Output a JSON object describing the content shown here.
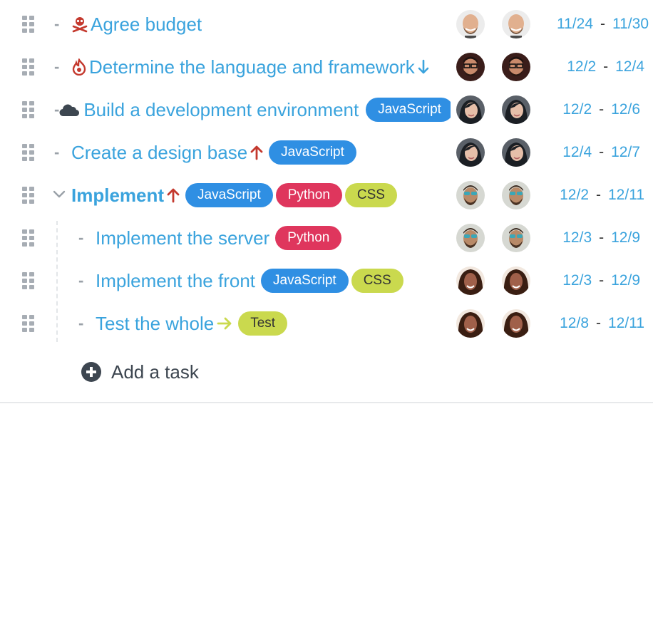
{
  "tasks": [
    {
      "title": "Agree budget",
      "icon": "skull-crossbones-icon",
      "arrow": "",
      "tags": [],
      "start": "11/24",
      "end": "11/30",
      "assignee": "bald-man"
    },
    {
      "title": "Determine the language and framework",
      "icon": "fire-icon",
      "arrow": "down",
      "tags": [],
      "start": "12/2",
      "end": "12/4",
      "assignee": "bearded-man-glasses"
    },
    {
      "title": "Build a development environment",
      "icon": "cloud-icon",
      "arrow": "",
      "tags": [
        "JavaScript"
      ],
      "start": "12/2",
      "end": "12/6",
      "assignee": "dark-haired-woman"
    },
    {
      "title": "Create a design base",
      "icon": "",
      "arrow": "up",
      "tags": [
        "JavaScript"
      ],
      "start": "12/4",
      "end": "12/7",
      "assignee": "dark-haired-woman"
    },
    {
      "title": "Implement",
      "icon": "",
      "arrow": "up",
      "tags": [
        "JavaScript",
        "Python",
        "CSS"
      ],
      "start": "12/2",
      "end": "12/11",
      "assignee": "man-sunglasses"
    },
    {
      "title": "Implement the server",
      "icon": "",
      "arrow": "",
      "tags": [
        "Python"
      ],
      "start": "12/3",
      "end": "12/9",
      "assignee": "man-sunglasses"
    },
    {
      "title": "Implement the front",
      "icon": "",
      "arrow": "",
      "tags": [
        "JavaScript",
        "CSS"
      ],
      "start": "12/3",
      "end": "12/9",
      "assignee": "curly-haired-woman"
    },
    {
      "title": "Test the whole",
      "icon": "",
      "arrow": "right",
      "tags": [
        "Test"
      ],
      "start": "12/8",
      "end": "12/11",
      "assignee": "curly-haired-woman"
    }
  ],
  "date_separator": "-",
  "bullet": "-",
  "add_task": {
    "label": "Add a task",
    "icon": "plus-circle-icon"
  },
  "colors": {
    "link": "#3aa3dd",
    "tag_javascript": "#2f8fe3",
    "tag_python": "#df365d",
    "tag_css": "#cad94e",
    "tag_test": "#cad94e",
    "priority_high": "#c4392e",
    "priority_low": "#3aa3dd",
    "arrow_right": "#cad94e"
  }
}
